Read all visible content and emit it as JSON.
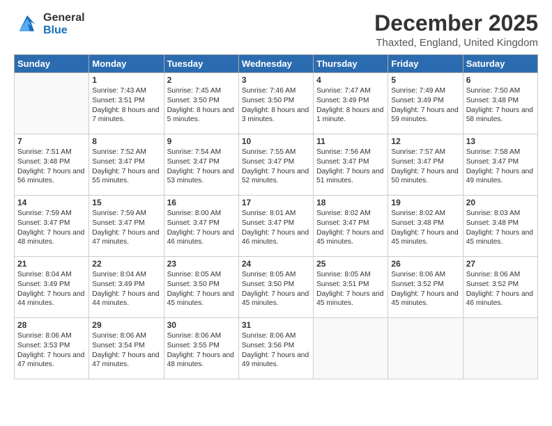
{
  "logo": {
    "line1": "General",
    "line2": "Blue"
  },
  "title": "December 2025",
  "subtitle": "Thaxted, England, United Kingdom",
  "days_header": [
    "Sunday",
    "Monday",
    "Tuesday",
    "Wednesday",
    "Thursday",
    "Friday",
    "Saturday"
  ],
  "weeks": [
    [
      {
        "num": "",
        "sunrise": "",
        "sunset": "",
        "daylight": ""
      },
      {
        "num": "1",
        "sunrise": "Sunrise: 7:43 AM",
        "sunset": "Sunset: 3:51 PM",
        "daylight": "Daylight: 8 hours and 7 minutes."
      },
      {
        "num": "2",
        "sunrise": "Sunrise: 7:45 AM",
        "sunset": "Sunset: 3:50 PM",
        "daylight": "Daylight: 8 hours and 5 minutes."
      },
      {
        "num": "3",
        "sunrise": "Sunrise: 7:46 AM",
        "sunset": "Sunset: 3:50 PM",
        "daylight": "Daylight: 8 hours and 3 minutes."
      },
      {
        "num": "4",
        "sunrise": "Sunrise: 7:47 AM",
        "sunset": "Sunset: 3:49 PM",
        "daylight": "Daylight: 8 hours and 1 minute."
      },
      {
        "num": "5",
        "sunrise": "Sunrise: 7:49 AM",
        "sunset": "Sunset: 3:49 PM",
        "daylight": "Daylight: 7 hours and 59 minutes."
      },
      {
        "num": "6",
        "sunrise": "Sunrise: 7:50 AM",
        "sunset": "Sunset: 3:48 PM",
        "daylight": "Daylight: 7 hours and 58 minutes."
      }
    ],
    [
      {
        "num": "7",
        "sunrise": "Sunrise: 7:51 AM",
        "sunset": "Sunset: 3:48 PM",
        "daylight": "Daylight: 7 hours and 56 minutes."
      },
      {
        "num": "8",
        "sunrise": "Sunrise: 7:52 AM",
        "sunset": "Sunset: 3:47 PM",
        "daylight": "Daylight: 7 hours and 55 minutes."
      },
      {
        "num": "9",
        "sunrise": "Sunrise: 7:54 AM",
        "sunset": "Sunset: 3:47 PM",
        "daylight": "Daylight: 7 hours and 53 minutes."
      },
      {
        "num": "10",
        "sunrise": "Sunrise: 7:55 AM",
        "sunset": "Sunset: 3:47 PM",
        "daylight": "Daylight: 7 hours and 52 minutes."
      },
      {
        "num": "11",
        "sunrise": "Sunrise: 7:56 AM",
        "sunset": "Sunset: 3:47 PM",
        "daylight": "Daylight: 7 hours and 51 minutes."
      },
      {
        "num": "12",
        "sunrise": "Sunrise: 7:57 AM",
        "sunset": "Sunset: 3:47 PM",
        "daylight": "Daylight: 7 hours and 50 minutes."
      },
      {
        "num": "13",
        "sunrise": "Sunrise: 7:58 AM",
        "sunset": "Sunset: 3:47 PM",
        "daylight": "Daylight: 7 hours and 49 minutes."
      }
    ],
    [
      {
        "num": "14",
        "sunrise": "Sunrise: 7:59 AM",
        "sunset": "Sunset: 3:47 PM",
        "daylight": "Daylight: 7 hours and 48 minutes."
      },
      {
        "num": "15",
        "sunrise": "Sunrise: 7:59 AM",
        "sunset": "Sunset: 3:47 PM",
        "daylight": "Daylight: 7 hours and 47 minutes."
      },
      {
        "num": "16",
        "sunrise": "Sunrise: 8:00 AM",
        "sunset": "Sunset: 3:47 PM",
        "daylight": "Daylight: 7 hours and 46 minutes."
      },
      {
        "num": "17",
        "sunrise": "Sunrise: 8:01 AM",
        "sunset": "Sunset: 3:47 PM",
        "daylight": "Daylight: 7 hours and 46 minutes."
      },
      {
        "num": "18",
        "sunrise": "Sunrise: 8:02 AM",
        "sunset": "Sunset: 3:47 PM",
        "daylight": "Daylight: 7 hours and 45 minutes."
      },
      {
        "num": "19",
        "sunrise": "Sunrise: 8:02 AM",
        "sunset": "Sunset: 3:48 PM",
        "daylight": "Daylight: 7 hours and 45 minutes."
      },
      {
        "num": "20",
        "sunrise": "Sunrise: 8:03 AM",
        "sunset": "Sunset: 3:48 PM",
        "daylight": "Daylight: 7 hours and 45 minutes."
      }
    ],
    [
      {
        "num": "21",
        "sunrise": "Sunrise: 8:04 AM",
        "sunset": "Sunset: 3:49 PM",
        "daylight": "Daylight: 7 hours and 44 minutes."
      },
      {
        "num": "22",
        "sunrise": "Sunrise: 8:04 AM",
        "sunset": "Sunset: 3:49 PM",
        "daylight": "Daylight: 7 hours and 44 minutes."
      },
      {
        "num": "23",
        "sunrise": "Sunrise: 8:05 AM",
        "sunset": "Sunset: 3:50 PM",
        "daylight": "Daylight: 7 hours and 45 minutes."
      },
      {
        "num": "24",
        "sunrise": "Sunrise: 8:05 AM",
        "sunset": "Sunset: 3:50 PM",
        "daylight": "Daylight: 7 hours and 45 minutes."
      },
      {
        "num": "25",
        "sunrise": "Sunrise: 8:05 AM",
        "sunset": "Sunset: 3:51 PM",
        "daylight": "Daylight: 7 hours and 45 minutes."
      },
      {
        "num": "26",
        "sunrise": "Sunrise: 8:06 AM",
        "sunset": "Sunset: 3:52 PM",
        "daylight": "Daylight: 7 hours and 45 minutes."
      },
      {
        "num": "27",
        "sunrise": "Sunrise: 8:06 AM",
        "sunset": "Sunset: 3:52 PM",
        "daylight": "Daylight: 7 hours and 46 minutes."
      }
    ],
    [
      {
        "num": "28",
        "sunrise": "Sunrise: 8:06 AM",
        "sunset": "Sunset: 3:53 PM",
        "daylight": "Daylight: 7 hours and 47 minutes."
      },
      {
        "num": "29",
        "sunrise": "Sunrise: 8:06 AM",
        "sunset": "Sunset: 3:54 PM",
        "daylight": "Daylight: 7 hours and 47 minutes."
      },
      {
        "num": "30",
        "sunrise": "Sunrise: 8:06 AM",
        "sunset": "Sunset: 3:55 PM",
        "daylight": "Daylight: 7 hours and 48 minutes."
      },
      {
        "num": "31",
        "sunrise": "Sunrise: 8:06 AM",
        "sunset": "Sunset: 3:56 PM",
        "daylight": "Daylight: 7 hours and 49 minutes."
      },
      {
        "num": "",
        "sunrise": "",
        "sunset": "",
        "daylight": ""
      },
      {
        "num": "",
        "sunrise": "",
        "sunset": "",
        "daylight": ""
      },
      {
        "num": "",
        "sunrise": "",
        "sunset": "",
        "daylight": ""
      }
    ]
  ]
}
